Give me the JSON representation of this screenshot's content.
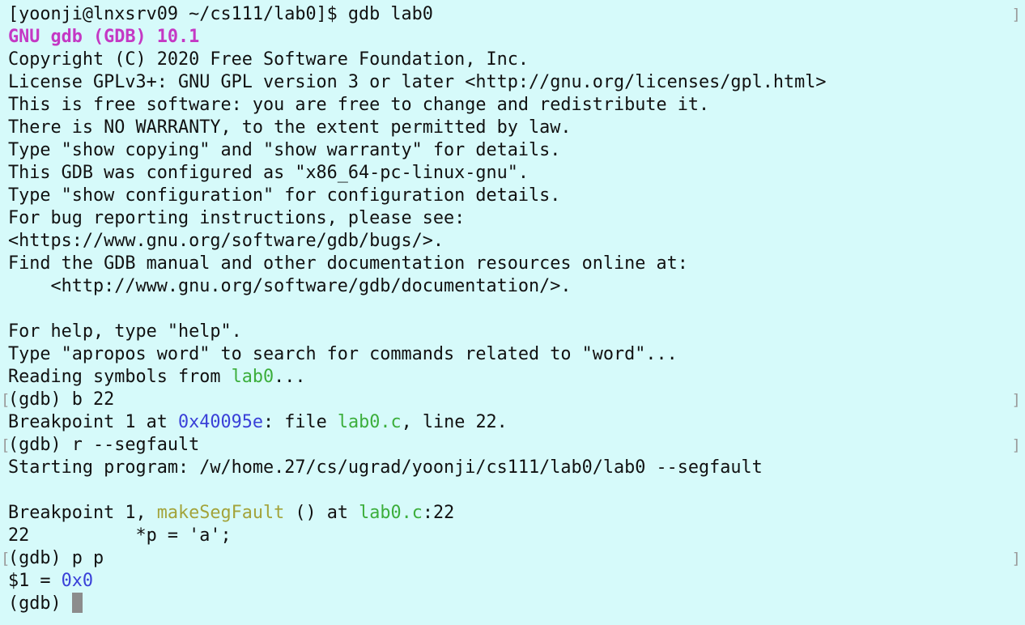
{
  "colors": {
    "background": "#d6fafa",
    "text": "#111111",
    "banner_magenta": "#c438c4",
    "file_green": "#3cae3c",
    "address_blue": "#3a40d8",
    "function_olive": "#a3a33a",
    "cursor_gray": "#8c8c8c"
  },
  "lines": {
    "l1": "[yoonji@lnxsrv09 ~/cs111/lab0]$ gdb lab0",
    "l2": "GNU gdb (GDB) 10.1",
    "l3": "Copyright (C) 2020 Free Software Foundation, Inc.",
    "l4": "License GPLv3+: GNU GPL version 3 or later <http://gnu.org/licenses/gpl.html>",
    "l5": "This is free software: you are free to change and redistribute it.",
    "l6": "There is NO WARRANTY, to the extent permitted by law.",
    "l7": "Type \"show copying\" and \"show warranty\" for details.",
    "l8": "This GDB was configured as \"x86_64-pc-linux-gnu\".",
    "l9": "Type \"show configuration\" for configuration details.",
    "l10": "For bug reporting instructions, please see:",
    "l11": "<https://www.gnu.org/software/gdb/bugs/>.",
    "l12": "Find the GDB manual and other documentation resources online at:",
    "l13": "    <http://www.gnu.org/software/gdb/documentation/>.",
    "l15": "For help, type \"help\".",
    "l16": "Type \"apropos word\" to search for commands related to \"word\"...",
    "l17a": "Reading symbols from ",
    "l17b": "lab0",
    "l17c": "...",
    "l18": "(gdb) b 22",
    "l19a": "Breakpoint 1 at ",
    "l19b": "0x40095e",
    "l19c": ": file ",
    "l19d": "lab0.c",
    "l19e": ", line 22.",
    "l20": "(gdb) r --segfault",
    "l21": "Starting program: /w/home.27/cs/ugrad/yoonji/cs111/lab0/lab0 --segfault",
    "l23a": "Breakpoint 1, ",
    "l23b": "makeSegFault",
    "l23c": " () at ",
    "l23d": "lab0.c",
    "l23e": ":22",
    "l24": "22          *p = 'a';",
    "l25": "(gdb) p p",
    "l26a": "$1 = ",
    "l26b": "0x0",
    "l27": "(gdb) "
  },
  "bracket_marks": {
    "left": "[",
    "right": "]"
  }
}
